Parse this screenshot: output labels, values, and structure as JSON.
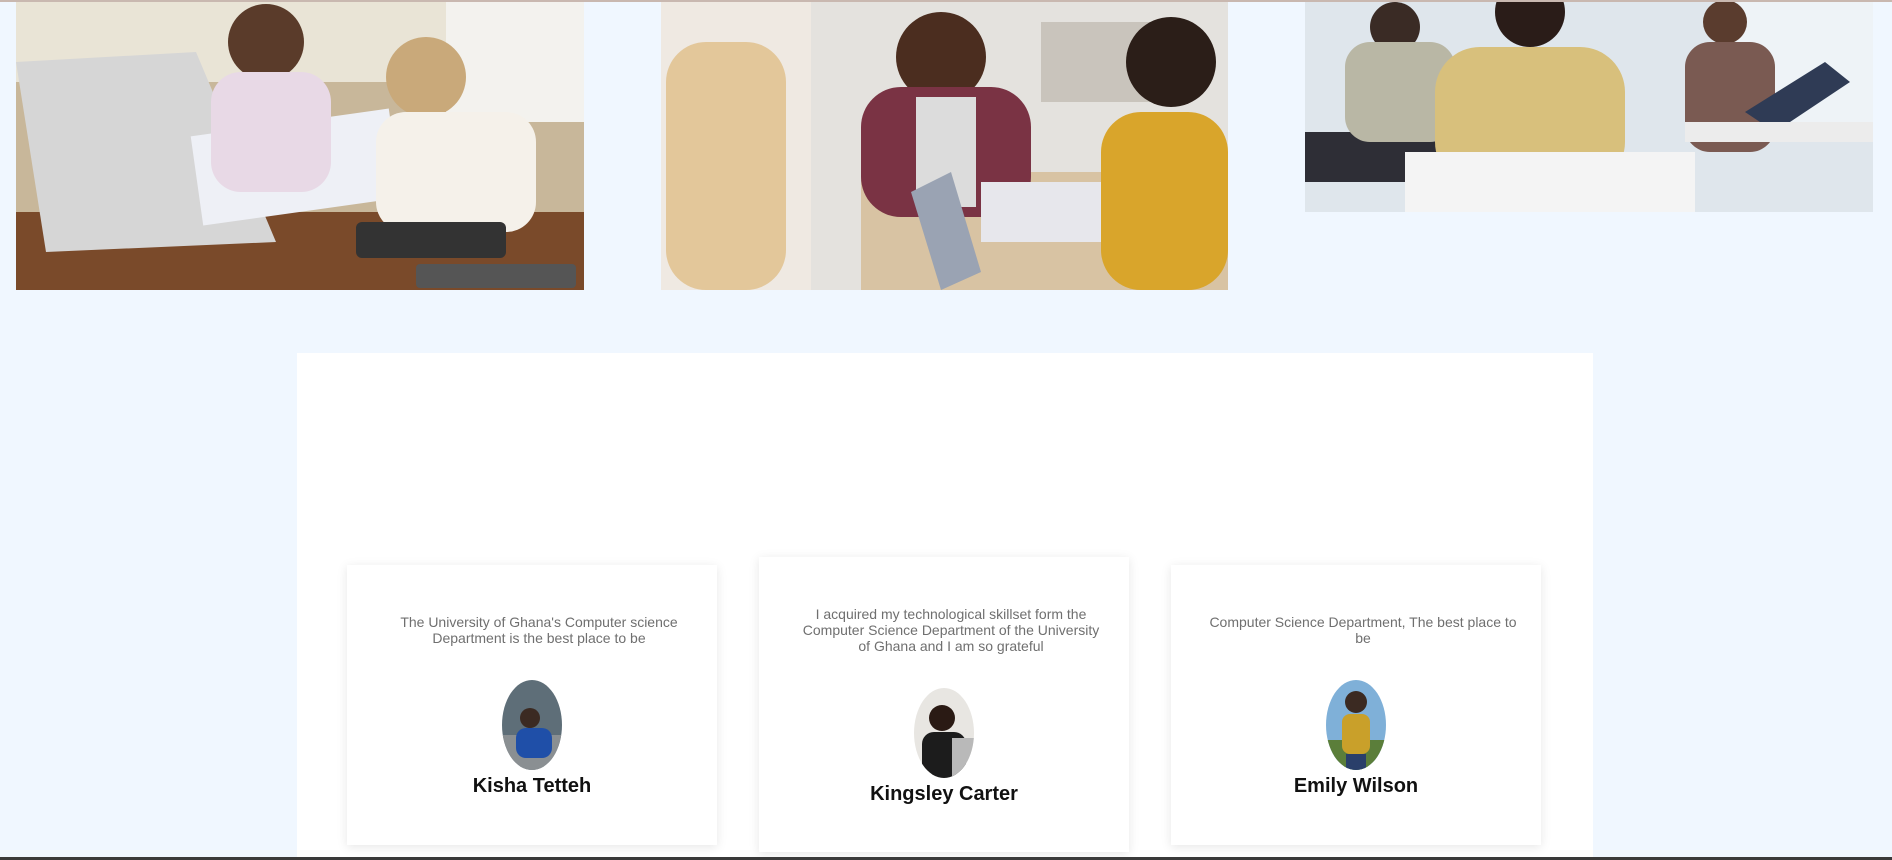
{
  "colors": {
    "page_background": "#f0f7ff",
    "panel_background": "#ffffff",
    "quote_text": "#6f6f6f",
    "name_text": "#111111"
  },
  "gallery": {
    "images": [
      {
        "alt": "photo-students-reviewing-charts"
      },
      {
        "alt": "photo-students-group-discussion"
      },
      {
        "alt": "photo-classroom-laptops"
      }
    ]
  },
  "testimonials": [
    {
      "quote": "The University of Ghana's Computer science Department is the best place to be",
      "name": "Kisha Tetteh"
    },
    {
      "quote": "I acquired my technological skillset form the Computer Science Department of the University of Ghana and I am so grateful",
      "name": "Kingsley Carter"
    },
    {
      "quote": "Computer Science Department, The best place to be",
      "name": "Emily Wilson"
    }
  ]
}
